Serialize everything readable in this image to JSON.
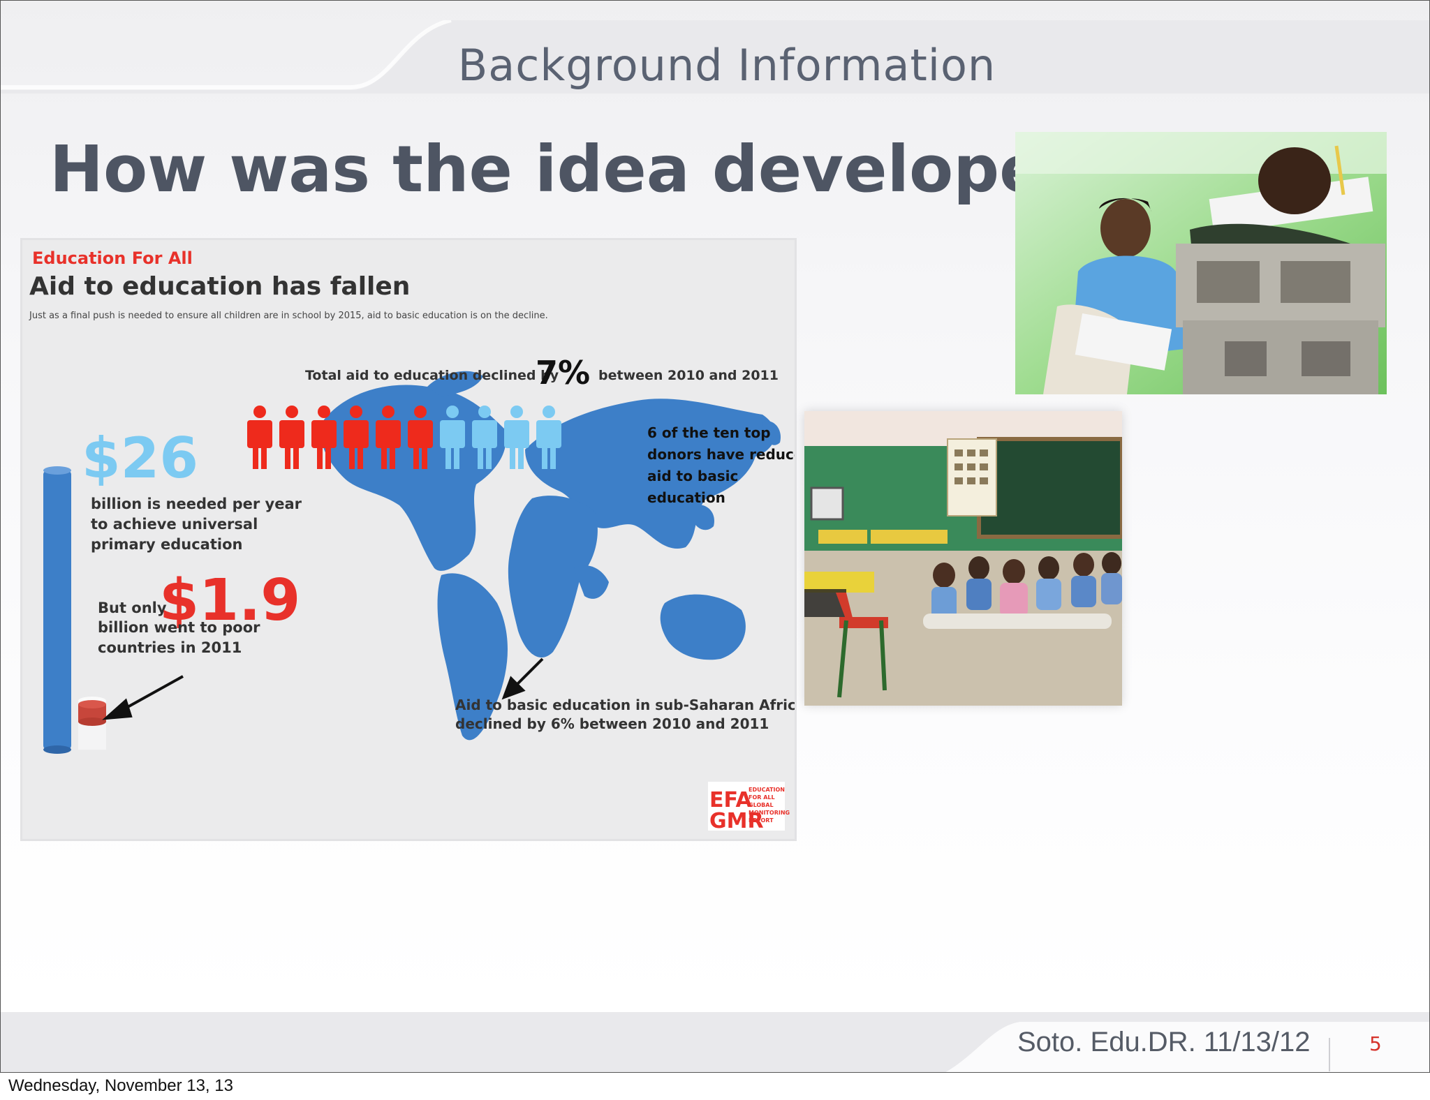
{
  "header": {
    "section_title": "Background Information"
  },
  "slide": {
    "heading": "How was the idea developed?"
  },
  "infographic": {
    "brand": "Education For All",
    "title": "Aid to education has fallen",
    "subtitle": "Just as a final push is needed to ensure all children are in school by 2015, aid to basic education is on the decline.",
    "total_prefix": "Total aid to education declined by",
    "total_percent": "7%",
    "total_suffix": "between 2010 and 2011",
    "need_amount": "$26",
    "need_text_lines": [
      "billion is needed per year",
      "to achieve universal",
      "primary education"
    ],
    "only_label": "But only",
    "only_amount": "$1.9",
    "only_text_lines": [
      "billion went to poor",
      "countries in 2011"
    ],
    "donors_lines": [
      "6 of the ten top",
      "donors have reduced",
      "aid to basic",
      "education"
    ],
    "africa_lines": [
      "Aid to basic education in sub-Saharan Africa",
      "declined by 6% between 2010 and 2011"
    ],
    "logo_letters": [
      "EFA",
      "GMR"
    ],
    "logo_words": [
      "EDUCATION",
      "FOR ALL",
      "GLOBAL",
      "MONITORING",
      "REPORT"
    ],
    "donors_reduced": 6,
    "donors_total": 10,
    "colors": {
      "red": "#ee2a1c",
      "light_blue": "#7ccaf2",
      "map_blue": "#3d7fc8",
      "brand_red": "#e8312a"
    }
  },
  "footer": {
    "credit": "Soto. Edu.DR. 11/13/12",
    "page_number": "5"
  },
  "date_label": "Wednesday, November 13, 13"
}
